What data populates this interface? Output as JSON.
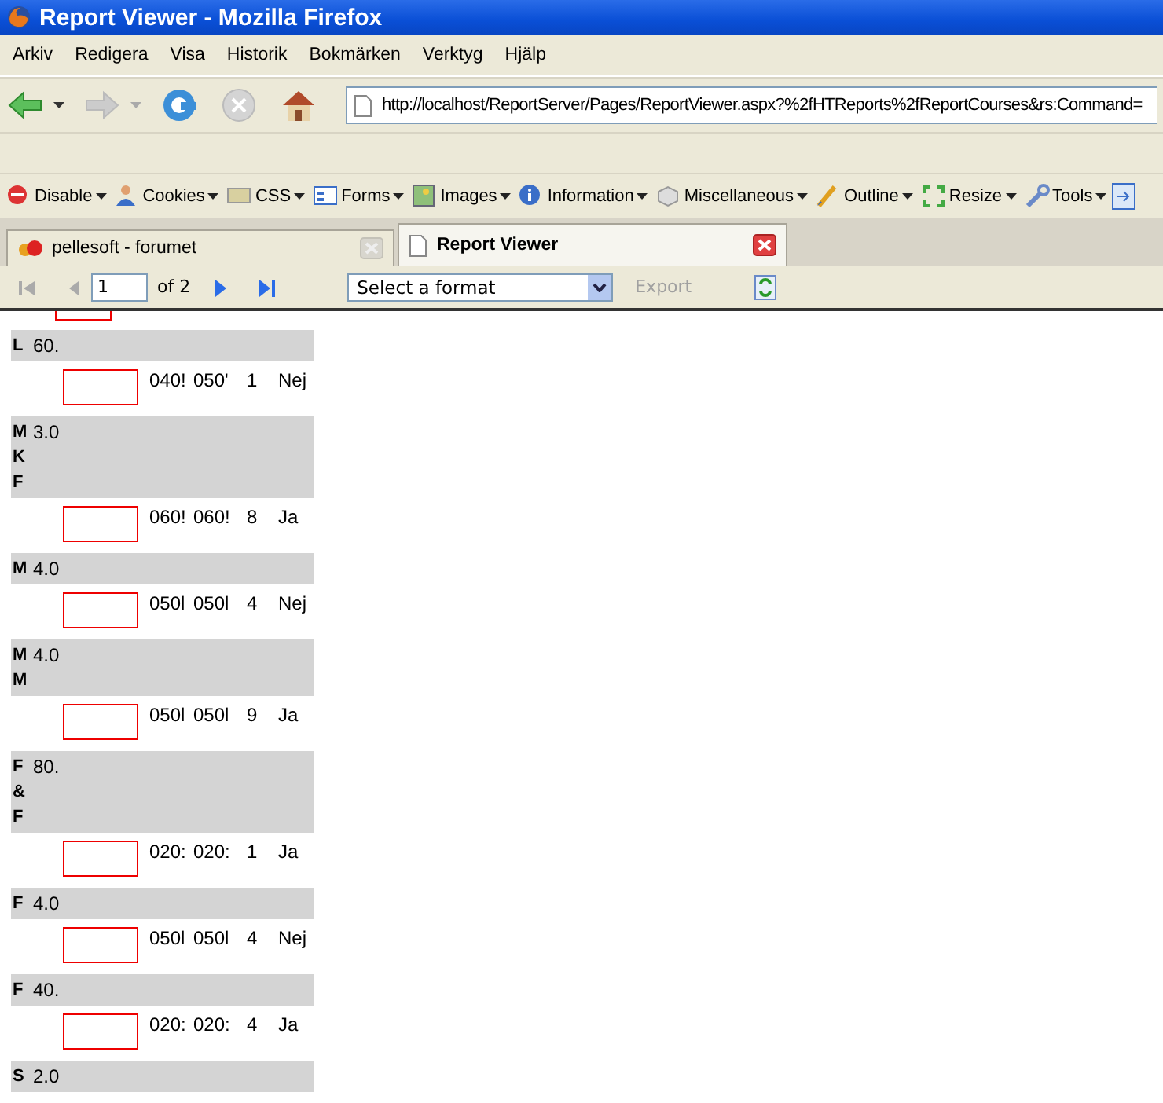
{
  "window": {
    "title": "Report Viewer - Mozilla Firefox"
  },
  "menu": [
    {
      "label": "Arkiv"
    },
    {
      "label": "Redigera"
    },
    {
      "label": "Visa"
    },
    {
      "label": "Historik"
    },
    {
      "label": "Bokmärken"
    },
    {
      "label": "Verktyg"
    },
    {
      "label": "Hjälp"
    }
  ],
  "navigation": {
    "buttons": [
      {
        "kind": "back",
        "disabled": false
      },
      {
        "kind": "forward",
        "disabled": true
      },
      {
        "kind": "reload",
        "disabled": false
      },
      {
        "kind": "stop",
        "disabled": true
      },
      {
        "kind": "home",
        "disabled": false
      }
    ],
    "address": "http://localhost/ReportServer/Pages/ReportViewer.aspx?%2fHTReports%2fReportCourses&rs:Command="
  },
  "dev_toolbar": [
    {
      "kind": "disable",
      "label": "Disable"
    },
    {
      "kind": "cookies",
      "label": "Cookies"
    },
    {
      "kind": "css",
      "label": "CSS"
    },
    {
      "kind": "forms",
      "label": "Forms"
    },
    {
      "kind": "images",
      "label": "Images"
    },
    {
      "kind": "information",
      "label": "Information"
    },
    {
      "kind": "miscellaneous",
      "label": "Miscellaneous"
    },
    {
      "kind": "outline",
      "label": "Outline"
    },
    {
      "kind": "resize",
      "label": "Resize"
    },
    {
      "kind": "tools",
      "label": "Tools"
    }
  ],
  "tabs": [
    {
      "label": "pellesoft - forumet",
      "selected": false
    },
    {
      "label": "Report Viewer",
      "selected": true
    }
  ],
  "report_toolbar": {
    "page": "1",
    "page_count": "of 2",
    "format": "Select a format",
    "export": {
      "label": "Export",
      "disabled": true
    }
  },
  "report": {
    "groups": [
      {
        "codes": [
          "L"
        ],
        "value": "60.",
        "row": [
          "040!",
          "050'",
          "1",
          "Nej"
        ]
      },
      {
        "codes": [
          "M",
          "K",
          "F"
        ],
        "value": "3.0",
        "row": [
          "060!",
          "060!",
          "8",
          "Ja"
        ]
      },
      {
        "codes": [
          "M"
        ],
        "value": "4.0",
        "row": [
          "050l",
          "050l",
          "4",
          "Nej"
        ]
      },
      {
        "codes": [
          "M",
          "M"
        ],
        "value": "4.0",
        "row": [
          "050l",
          "050l",
          "9",
          "Ja"
        ]
      },
      {
        "codes": [
          "F",
          "&",
          "F"
        ],
        "value": "80.",
        "row": [
          "020:",
          "020:",
          "1",
          "Ja"
        ]
      },
      {
        "codes": [
          "F"
        ],
        "value": "4.0",
        "row": [
          "050l",
          "050l",
          "4",
          "Nej"
        ]
      },
      {
        "codes": [
          "F"
        ],
        "value": "40.",
        "row": [
          "020:",
          "020:",
          "4",
          "Ja"
        ]
      },
      {
        "codes": [
          "S"
        ],
        "value": "2.0"
      }
    ]
  }
}
